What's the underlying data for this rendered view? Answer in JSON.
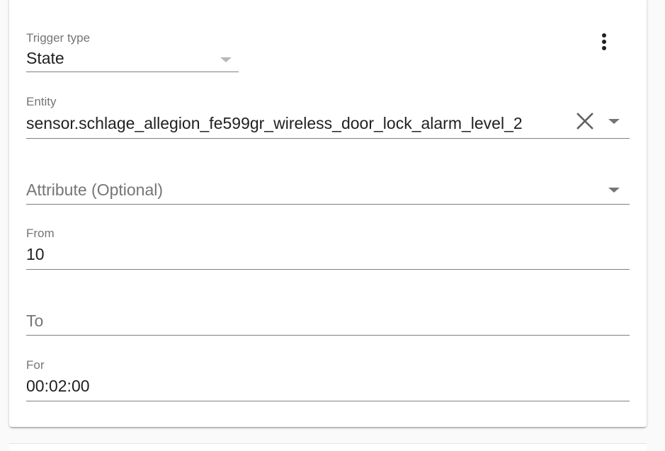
{
  "trigger_type": {
    "label": "Trigger type",
    "value": "State"
  },
  "menu": {
    "icon": "dots-vertical-icon"
  },
  "entity": {
    "label": "Entity",
    "value": "sensor.schlage_allegion_fe599gr_wireless_door_lock_alarm_level_2",
    "clear_icon": "close-icon",
    "dropdown_icon": "chevron-down-icon"
  },
  "attribute": {
    "placeholder": "Attribute (Optional)",
    "dropdown_icon": "chevron-down-icon"
  },
  "from": {
    "label": "From",
    "value": "10"
  },
  "to": {
    "placeholder": "To"
  },
  "for": {
    "label": "For",
    "value": "00:02:00"
  },
  "colors": {
    "text_primary": "#212121",
    "text_secondary": "#757575",
    "underline": "#7f7f7f",
    "card_background": "#ffffff",
    "page_background": "#fafafa"
  }
}
